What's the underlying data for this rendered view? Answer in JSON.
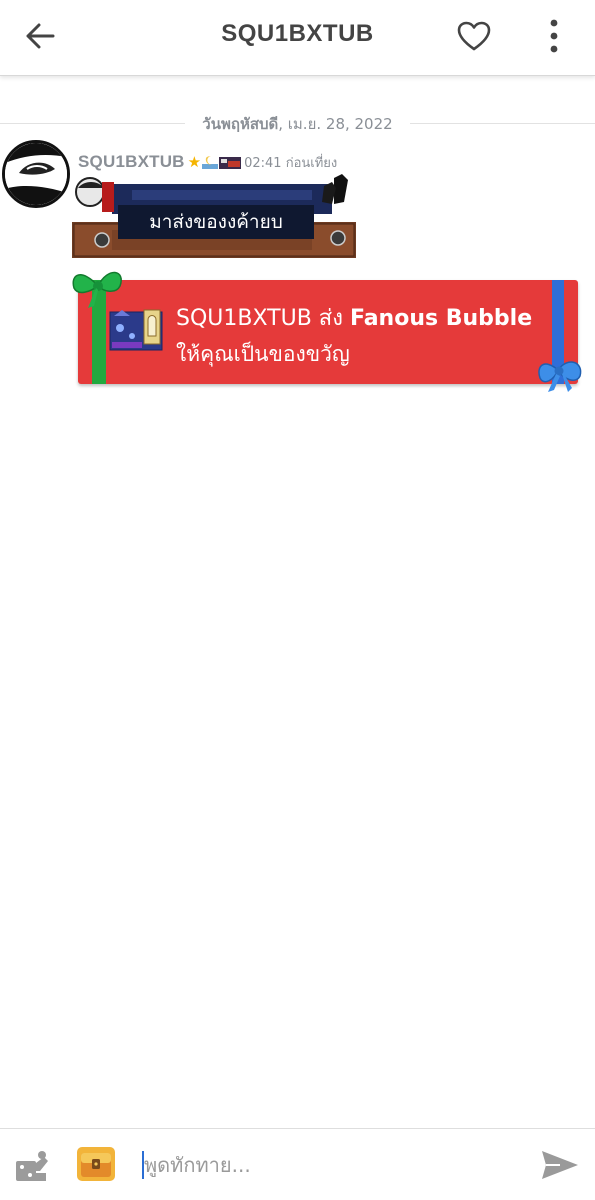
{
  "header": {
    "title": "SQU1BXTUB",
    "back_icon": "arrow-left-icon",
    "favorite_icon": "heart-outline-icon",
    "more_icon": "more-vertical-icon"
  },
  "chat": {
    "date_separator": {
      "day": "วันพฤหัสบดี",
      "rest": ", เม.ย. 28, 2022"
    },
    "messages": [
      {
        "username": "SQU1BXTUB",
        "badges": [
          "star-icon",
          "moon-icon",
          "bed-icon"
        ],
        "time": "02:41 ก่อนเที่ยง",
        "text": "มาส่งของงค้ายบ"
      }
    ],
    "gift": {
      "sender": "SQU1BXTUB",
      "verb": " ส่ง ",
      "item": "Fanous Bubble",
      "line2": "ให้คุณเป็นของขวัญ",
      "ribbon_color": "#22a93f",
      "card_color": "#e53a3a"
    }
  },
  "composer": {
    "placeholder": "พูดทักทาย...",
    "value": "",
    "tools_icon": "dice-tools-icon",
    "chest_icon": "treasure-chest-icon",
    "send_icon": "send-icon"
  }
}
